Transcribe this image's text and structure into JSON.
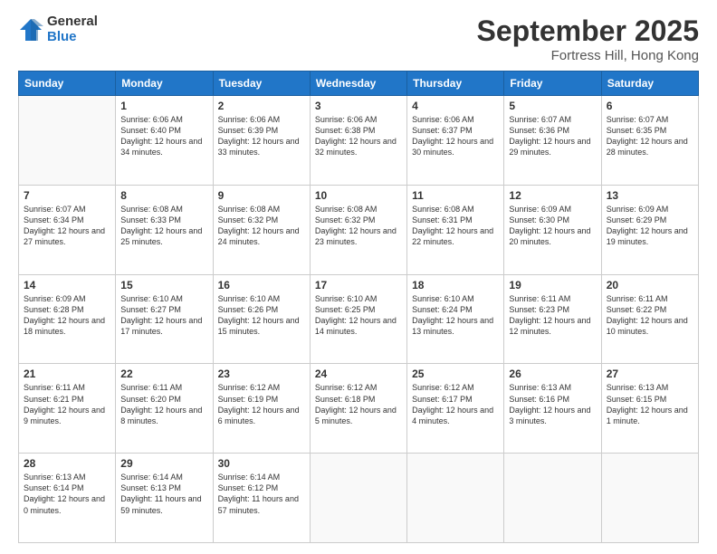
{
  "logo": {
    "general": "General",
    "blue": "Blue"
  },
  "title": {
    "month": "September 2025",
    "location": "Fortress Hill, Hong Kong"
  },
  "weekdays": [
    "Sunday",
    "Monday",
    "Tuesday",
    "Wednesday",
    "Thursday",
    "Friday",
    "Saturday"
  ],
  "weeks": [
    [
      {
        "day": "",
        "sunrise": "",
        "sunset": "",
        "daylight": ""
      },
      {
        "day": "1",
        "sunrise": "Sunrise: 6:06 AM",
        "sunset": "Sunset: 6:40 PM",
        "daylight": "Daylight: 12 hours and 34 minutes."
      },
      {
        "day": "2",
        "sunrise": "Sunrise: 6:06 AM",
        "sunset": "Sunset: 6:39 PM",
        "daylight": "Daylight: 12 hours and 33 minutes."
      },
      {
        "day": "3",
        "sunrise": "Sunrise: 6:06 AM",
        "sunset": "Sunset: 6:38 PM",
        "daylight": "Daylight: 12 hours and 32 minutes."
      },
      {
        "day": "4",
        "sunrise": "Sunrise: 6:06 AM",
        "sunset": "Sunset: 6:37 PM",
        "daylight": "Daylight: 12 hours and 30 minutes."
      },
      {
        "day": "5",
        "sunrise": "Sunrise: 6:07 AM",
        "sunset": "Sunset: 6:36 PM",
        "daylight": "Daylight: 12 hours and 29 minutes."
      },
      {
        "day": "6",
        "sunrise": "Sunrise: 6:07 AM",
        "sunset": "Sunset: 6:35 PM",
        "daylight": "Daylight: 12 hours and 28 minutes."
      }
    ],
    [
      {
        "day": "7",
        "sunrise": "Sunrise: 6:07 AM",
        "sunset": "Sunset: 6:34 PM",
        "daylight": "Daylight: 12 hours and 27 minutes."
      },
      {
        "day": "8",
        "sunrise": "Sunrise: 6:08 AM",
        "sunset": "Sunset: 6:33 PM",
        "daylight": "Daylight: 12 hours and 25 minutes."
      },
      {
        "day": "9",
        "sunrise": "Sunrise: 6:08 AM",
        "sunset": "Sunset: 6:32 PM",
        "daylight": "Daylight: 12 hours and 24 minutes."
      },
      {
        "day": "10",
        "sunrise": "Sunrise: 6:08 AM",
        "sunset": "Sunset: 6:32 PM",
        "daylight": "Daylight: 12 hours and 23 minutes."
      },
      {
        "day": "11",
        "sunrise": "Sunrise: 6:08 AM",
        "sunset": "Sunset: 6:31 PM",
        "daylight": "Daylight: 12 hours and 22 minutes."
      },
      {
        "day": "12",
        "sunrise": "Sunrise: 6:09 AM",
        "sunset": "Sunset: 6:30 PM",
        "daylight": "Daylight: 12 hours and 20 minutes."
      },
      {
        "day": "13",
        "sunrise": "Sunrise: 6:09 AM",
        "sunset": "Sunset: 6:29 PM",
        "daylight": "Daylight: 12 hours and 19 minutes."
      }
    ],
    [
      {
        "day": "14",
        "sunrise": "Sunrise: 6:09 AM",
        "sunset": "Sunset: 6:28 PM",
        "daylight": "Daylight: 12 hours and 18 minutes."
      },
      {
        "day": "15",
        "sunrise": "Sunrise: 6:10 AM",
        "sunset": "Sunset: 6:27 PM",
        "daylight": "Daylight: 12 hours and 17 minutes."
      },
      {
        "day": "16",
        "sunrise": "Sunrise: 6:10 AM",
        "sunset": "Sunset: 6:26 PM",
        "daylight": "Daylight: 12 hours and 15 minutes."
      },
      {
        "day": "17",
        "sunrise": "Sunrise: 6:10 AM",
        "sunset": "Sunset: 6:25 PM",
        "daylight": "Daylight: 12 hours and 14 minutes."
      },
      {
        "day": "18",
        "sunrise": "Sunrise: 6:10 AM",
        "sunset": "Sunset: 6:24 PM",
        "daylight": "Daylight: 12 hours and 13 minutes."
      },
      {
        "day": "19",
        "sunrise": "Sunrise: 6:11 AM",
        "sunset": "Sunset: 6:23 PM",
        "daylight": "Daylight: 12 hours and 12 minutes."
      },
      {
        "day": "20",
        "sunrise": "Sunrise: 6:11 AM",
        "sunset": "Sunset: 6:22 PM",
        "daylight": "Daylight: 12 hours and 10 minutes."
      }
    ],
    [
      {
        "day": "21",
        "sunrise": "Sunrise: 6:11 AM",
        "sunset": "Sunset: 6:21 PM",
        "daylight": "Daylight: 12 hours and 9 minutes."
      },
      {
        "day": "22",
        "sunrise": "Sunrise: 6:11 AM",
        "sunset": "Sunset: 6:20 PM",
        "daylight": "Daylight: 12 hours and 8 minutes."
      },
      {
        "day": "23",
        "sunrise": "Sunrise: 6:12 AM",
        "sunset": "Sunset: 6:19 PM",
        "daylight": "Daylight: 12 hours and 6 minutes."
      },
      {
        "day": "24",
        "sunrise": "Sunrise: 6:12 AM",
        "sunset": "Sunset: 6:18 PM",
        "daylight": "Daylight: 12 hours and 5 minutes."
      },
      {
        "day": "25",
        "sunrise": "Sunrise: 6:12 AM",
        "sunset": "Sunset: 6:17 PM",
        "daylight": "Daylight: 12 hours and 4 minutes."
      },
      {
        "day": "26",
        "sunrise": "Sunrise: 6:13 AM",
        "sunset": "Sunset: 6:16 PM",
        "daylight": "Daylight: 12 hours and 3 minutes."
      },
      {
        "day": "27",
        "sunrise": "Sunrise: 6:13 AM",
        "sunset": "Sunset: 6:15 PM",
        "daylight": "Daylight: 12 hours and 1 minute."
      }
    ],
    [
      {
        "day": "28",
        "sunrise": "Sunrise: 6:13 AM",
        "sunset": "Sunset: 6:14 PM",
        "daylight": "Daylight: 12 hours and 0 minutes."
      },
      {
        "day": "29",
        "sunrise": "Sunrise: 6:14 AM",
        "sunset": "Sunset: 6:13 PM",
        "daylight": "Daylight: 11 hours and 59 minutes."
      },
      {
        "day": "30",
        "sunrise": "Sunrise: 6:14 AM",
        "sunset": "Sunset: 6:12 PM",
        "daylight": "Daylight: 11 hours and 57 minutes."
      },
      {
        "day": "",
        "sunrise": "",
        "sunset": "",
        "daylight": ""
      },
      {
        "day": "",
        "sunrise": "",
        "sunset": "",
        "daylight": ""
      },
      {
        "day": "",
        "sunrise": "",
        "sunset": "",
        "daylight": ""
      },
      {
        "day": "",
        "sunrise": "",
        "sunset": "",
        "daylight": ""
      }
    ]
  ]
}
